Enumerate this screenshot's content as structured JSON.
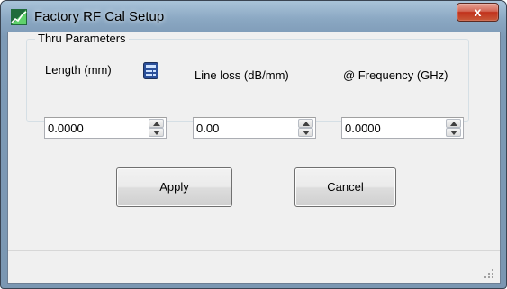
{
  "window": {
    "title": "Factory RF Cal Setup",
    "close_label": "x",
    "icon": "app-icon",
    "colors": {
      "frame": "#7d9ab6",
      "close": "#c1311b",
      "client": "#f0f0f0"
    }
  },
  "thru_parameters": {
    "legend": "Thru Parameters",
    "length": {
      "label": "Length (mm)",
      "value": "0.0000",
      "icon": "calculator-icon"
    },
    "line_loss": {
      "label": "Line loss (dB/mm)",
      "value": "0.00"
    },
    "frequency": {
      "label": "@ Frequency (GHz)",
      "value": "0.0000"
    }
  },
  "buttons": {
    "apply": "Apply",
    "cancel": "Cancel"
  },
  "statusbar": {
    "icon": "resize-grip-icon"
  }
}
